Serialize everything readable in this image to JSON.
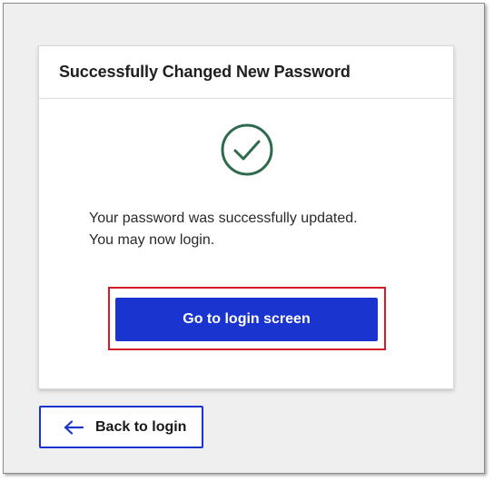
{
  "card": {
    "title": "Successfully Changed New Password",
    "message_line1": "Your password was successfully updated.",
    "message_line2": "You may now login.",
    "icon": "check-circle-icon"
  },
  "actions": {
    "primary_label": "Go to login screen",
    "back_label": "Back to login",
    "back_icon": "arrow-left-icon"
  },
  "colors": {
    "accent": "#1a35cf",
    "success": "#2e6b4c",
    "highlight": "#d11a2a"
  }
}
